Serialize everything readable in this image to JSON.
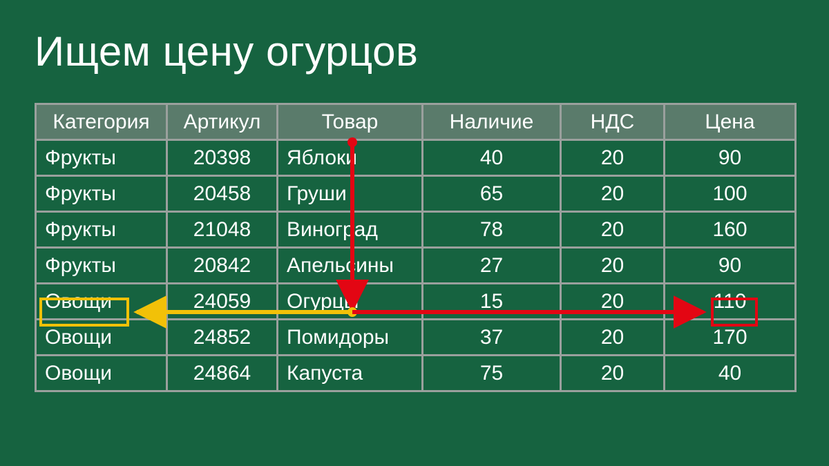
{
  "title": "Ищем цену огурцов",
  "headers": [
    "Категория",
    "Артикул",
    "Товар",
    "Наличие",
    "НДС",
    "Цена"
  ],
  "rows": [
    {
      "category": "Фрукты",
      "sku": "20398",
      "product": "Яблоки",
      "stock": "40",
      "vat": "20",
      "price": "90"
    },
    {
      "category": "Фрукты",
      "sku": "20458",
      "product": "Груши",
      "stock": "65",
      "vat": "20",
      "price": "100"
    },
    {
      "category": "Фрукты",
      "sku": "21048",
      "product": "Виноград",
      "stock": "78",
      "vat": "20",
      "price": "160"
    },
    {
      "category": "Фрукты",
      "sku": "20842",
      "product": "Апельсины",
      "stock": "27",
      "vat": "20",
      "price": "90"
    },
    {
      "category": "Овощи",
      "sku": "24059",
      "product": "Огурцы",
      "stock": "15",
      "vat": "20",
      "price": "110"
    },
    {
      "category": "Овощи",
      "sku": "24852",
      "product": "Помидоры",
      "stock": "37",
      "vat": "20",
      "price": "170"
    },
    {
      "category": "Овощи",
      "sku": "24864",
      "product": "Капуста",
      "stock": "75",
      "vat": "20",
      "price": "40"
    }
  ],
  "highlight": {
    "yellow_cell": "Овощи",
    "red_cell": "110"
  },
  "colors": {
    "bg": "#166340",
    "header_bg": "#5a7b6b",
    "border": "#9aa09d",
    "yellow": "#f2c108",
    "red": "#e30613"
  },
  "chart_data": {
    "type": "table",
    "title": "Ищем цену огурцов",
    "columns": [
      "Категория",
      "Артикул",
      "Товар",
      "Наличие",
      "НДС",
      "Цена"
    ],
    "data": [
      [
        "Фрукты",
        20398,
        "Яблоки",
        40,
        20,
        90
      ],
      [
        "Фрукты",
        20458,
        "Груши",
        65,
        20,
        100
      ],
      [
        "Фрукты",
        21048,
        "Виноград",
        78,
        20,
        160
      ],
      [
        "Фрукты",
        20842,
        "Апельсины",
        27,
        20,
        90
      ],
      [
        "Овощи",
        24059,
        "Огурцы",
        15,
        20,
        110
      ],
      [
        "Овощи",
        24852,
        "Помидоры",
        37,
        20,
        170
      ],
      [
        "Овощи",
        24864,
        "Капуста",
        75,
        20,
        40
      ]
    ],
    "lookup_arrows": {
      "vertical": {
        "from_row_header": true,
        "to_row_index": 4,
        "column": "Товар"
      },
      "left": {
        "row_index": 4,
        "to_column": "Категория"
      },
      "right": {
        "row_index": 4,
        "to_column": "Цена"
      }
    }
  }
}
